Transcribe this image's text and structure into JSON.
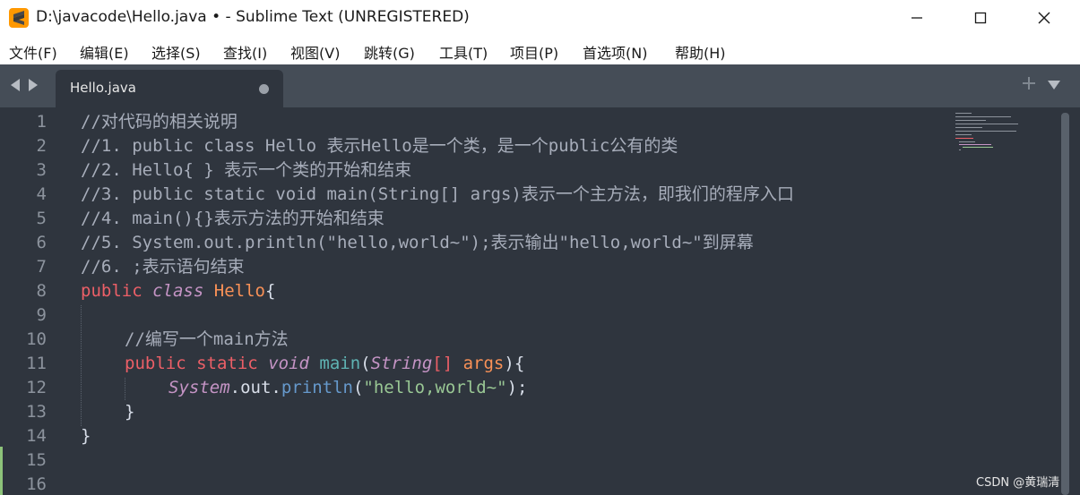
{
  "window": {
    "title": "D:\\javacode\\Hello.java • - Sublime Text (UNREGISTERED)"
  },
  "menu": [
    "文件(F)",
    "编辑(E)",
    "选择(S)",
    "查找(I)",
    "视图(V)",
    "跳转(G)",
    "工具(T)",
    "项目(P)",
    "首选项(N)",
    "帮助(H)"
  ],
  "tab": {
    "label": "Hello.java",
    "modified": true
  },
  "line_numbers": [
    "1",
    "2",
    "3",
    "4",
    "5",
    "6",
    "7",
    "8",
    "9",
    "10",
    "11",
    "12",
    "13",
    "14",
    "15",
    "16"
  ],
  "code": {
    "l1": "//对代码的相关说明",
    "l2": "//1. public class Hello 表示Hello是一个类，是一个public公有的类",
    "l3": "//2. Hello{ } 表示一个类的开始和结束",
    "l4": "//3. public static void main(String[] args)表示一个主方法，即我们的程序入口",
    "l5": "//4. main(){}表示方法的开始和结束",
    "l6": "//5. System.out.println(\"hello,world~\");表示输出\"hello,world~\"到屏幕",
    "l7": "//6. ;表示语句结束",
    "l8": {
      "kw": "public",
      "storage": "class",
      "cls": "Hello",
      "brace": "{"
    },
    "l10": "//编写一个main方法",
    "l11": {
      "kw1": "public",
      "kw2": "static",
      "storage": "void",
      "fn": "main",
      "open": "(",
      "type": "String",
      "arr": "[]",
      "param": "args",
      "close": "){"
    },
    "l12": {
      "obj": "System",
      "dot1": ".",
      "field": "out",
      "dot2": ".",
      "method": "println",
      "open": "(",
      "str": "\"hello,world~\"",
      "close": ");"
    },
    "l13": "}",
    "l14": "}"
  },
  "watermark": "CSDN @黄瑞清",
  "colors": {
    "editor_bg": "#2f353e",
    "tabbar_bg": "#454d57",
    "keyword": "#ec5f67",
    "storage": "#c594c5",
    "class_name": "#f99157",
    "string": "#99c794",
    "function": "#6699cc",
    "comment": "#a7adba"
  }
}
